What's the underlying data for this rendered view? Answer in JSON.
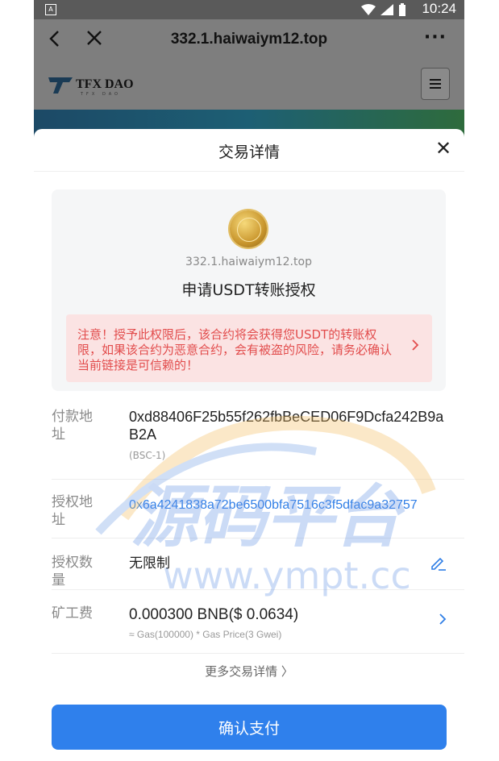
{
  "status_bar": {
    "time": "10:24",
    "notif_icon": "A"
  },
  "browser": {
    "url": "332.1.haiwaiym12.top",
    "back_icon": "back-arrow-icon",
    "close_icon": "close-icon",
    "more_icon": "more-dots-icon",
    "more_label": "···"
  },
  "site": {
    "logo_text": "TFX DAO",
    "logo_sub": "TFX DAO",
    "menu_icon": "hamburger-icon"
  },
  "sheet": {
    "title": "交易详情",
    "close_label": "✕",
    "domain": "332.1.haiwaiym12.top",
    "request": "申请USDT转账授权",
    "warning": "注意！授予此权限后，该合约将会获得您USDT的转账权限，如果该合约为恶意合约，会有被盗的风险，请务必确认当前链接是可信赖的！",
    "rows": [
      {
        "label": "付款地址",
        "value": "0xd88406F25b55f262fbBeCED06F9Dcfa242B9aB2A",
        "note": "(BSC-1)"
      },
      {
        "label": "授权地址",
        "value": "0x6a4241838a72be6500bfa7516c3f5dfac9a32757"
      },
      {
        "label": "授权数量",
        "value": "无限制"
      },
      {
        "label": "矿工费",
        "value": "0.000300 BNB($ 0.0634)",
        "note": "≈ Gas(100000) * Gas Price(3 Gwei)"
      }
    ],
    "more_details": "更多交易详情 〉",
    "confirm": "确认支付"
  },
  "watermark": {
    "text1": "源码平台",
    "text2": "www.ympt.cc"
  },
  "colors": {
    "accent": "#2f80ec",
    "warning_text": "#e24c4c",
    "warning_bg": "#fbe3e3"
  }
}
